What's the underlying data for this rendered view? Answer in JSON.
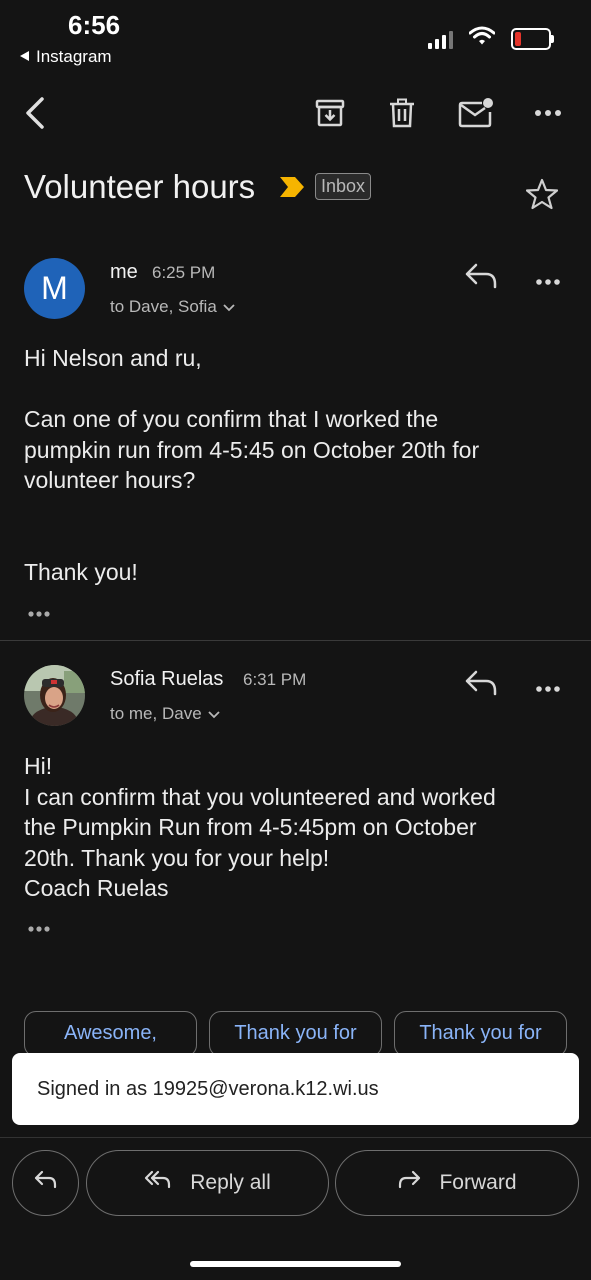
{
  "status_bar": {
    "time": "6:56",
    "back_app": "Instagram"
  },
  "email": {
    "subject": "Volunteer hours",
    "label": "Inbox"
  },
  "messages": [
    {
      "avatar_letter": "M",
      "sender": "me",
      "time": "6:25 PM",
      "recipients": "to Dave, Sofia",
      "body_lines": [
        "Hi Nelson and ru,",
        "",
        "Can one of you confirm that I worked the",
        "pumpkin run from 4-5:45 on October 20th for",
        "volunteer hours?",
        "",
        "",
        "Thank you!"
      ]
    },
    {
      "sender": "Sofia Ruelas",
      "time": "6:31 PM",
      "recipients": "to me, Dave",
      "body_lines": [
        "Hi!",
        "I can confirm that you volunteered and worked",
        "the Pumpkin Run from 4-5:45pm on October",
        "20th. Thank you for your help!",
        "Coach Ruelas"
      ]
    }
  ],
  "smart_replies": [
    "Awesome,",
    "Thank you for",
    "Thank you for"
  ],
  "toast": "Signed in as 19925@verona.k12.wi.us",
  "bottom_actions": {
    "reply_all": "Reply all",
    "forward": "Forward"
  },
  "icons": {
    "toolbar": [
      "back-arrow-icon",
      "archive-icon",
      "trash-icon",
      "mark-unread-icon",
      "more-icon"
    ],
    "accent_blue": "#8ab4f8",
    "avatar_blue": "#1f63b8",
    "important_yellow": "#f6b400"
  }
}
